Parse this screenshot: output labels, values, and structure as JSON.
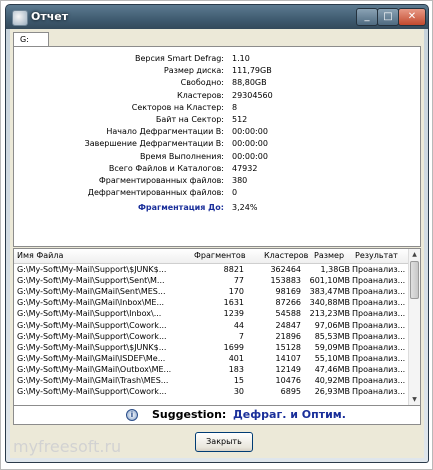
{
  "window": {
    "title": "Отчет"
  },
  "tab": {
    "label": "G:"
  },
  "info": [
    {
      "label": "Версия Smart Defrag:",
      "value": "1.10"
    },
    {
      "label": "Размер диска:",
      "value": "111,79GB"
    },
    {
      "label": "Свободно:",
      "value": "88,80GB"
    },
    {
      "label": "Кластеров:",
      "value": "29304560"
    },
    {
      "label": "Секторов на Кластер:",
      "value": "8"
    },
    {
      "label": "Байт на Сектор:",
      "value": "512"
    },
    {
      "label": "Начало Дефрагментации В:",
      "value": "00:00:00"
    },
    {
      "label": "Завершение Дефрагментации В:",
      "value": "00:00:00"
    },
    {
      "label": "Время Выполнения:",
      "value": "00:00:00"
    },
    {
      "label": "Всего Файлов и Каталогов:",
      "value": "47932"
    },
    {
      "label": "Фрагментированных файлов:",
      "value": "380"
    },
    {
      "label": "Дефрагментированных файлов:",
      "value": "0"
    },
    {
      "label": "Фрагментация До:",
      "value": "3,24%"
    }
  ],
  "list": {
    "columns": [
      "Имя Файла",
      "Фрагментов",
      "Кластеров",
      "Размер",
      "Результат"
    ],
    "rows": [
      [
        "G:\\My-Soft\\My-Mail\\Support\\$JUNK$...",
        "8821",
        "362464",
        "1,38GB",
        "Проанализ..."
      ],
      [
        "G:\\My-Soft\\My-Mail\\Support\\Sent\\M...",
        "77",
        "153883",
        "601,10MB",
        "Проанализ..."
      ],
      [
        "G:\\My-Soft\\My-Mail\\GMail\\Sent\\MES...",
        "170",
        "98169",
        "383,47MB",
        "Проанализ..."
      ],
      [
        "G:\\My-Soft\\My-Mail\\GMail\\Inbox\\ME...",
        "1631",
        "87266",
        "340,88MB",
        "Проанализ..."
      ],
      [
        "G:\\My-Soft\\My-Mail\\Support\\Inbox\\...",
        "1239",
        "54588",
        "213,23MB",
        "Проанализ..."
      ],
      [
        "G:\\My-Soft\\My-Mail\\Support\\Cowork...",
        "44",
        "24847",
        "97,06MB",
        "Проанализ..."
      ],
      [
        "G:\\My-Soft\\My-Mail\\Support\\Cowork...",
        "7",
        "21896",
        "85,53MB",
        "Проанализ..."
      ],
      [
        "G:\\My-Soft\\My-Mail\\Support\\$JUNK$...",
        "1699",
        "15128",
        "59,09MB",
        "Проанализ..."
      ],
      [
        "G:\\My-Soft\\My-Mail\\GMail\\ISDEF\\Me...",
        "401",
        "14107",
        "55,10MB",
        "Проанализ..."
      ],
      [
        "G:\\My-Soft\\My-Mail\\GMail\\Outbox\\ME...",
        "183",
        "12149",
        "47,46MB",
        "Проанализ..."
      ],
      [
        "G:\\My-Soft\\My-Mail\\GMail\\Trash\\MES...",
        "15",
        "10476",
        "40,92MB",
        "Проанализ..."
      ],
      [
        "G:\\My-Soft\\My-Mail\\Support\\Cowork...",
        "30",
        "6895",
        "26,93MB",
        "Проанализ..."
      ]
    ]
  },
  "suggestion": {
    "label": "Suggestion:",
    "text": "Дефраг. и Оптим."
  },
  "buttons": {
    "close": "Закрыть"
  },
  "watermark": "myfreesoft.ru",
  "icons": {
    "app": "defrag-app-icon",
    "info": "info-icon"
  }
}
